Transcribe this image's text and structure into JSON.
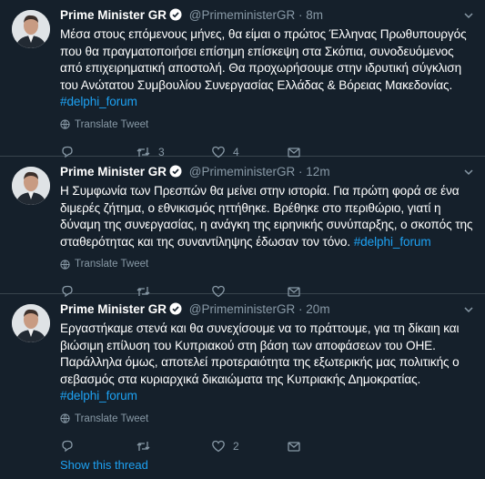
{
  "tweets": [
    {
      "name": "Prime Minister GR",
      "handle": "@PrimeministerGR",
      "dot": "·",
      "time": "8m",
      "text": "Μέσα στους επόμενους μήνες, θα είμαι ο πρώτος Έλληνας Πρωθυπουργός που θα πραγματοποιήσει επίσημη επίσκεψη στα Σκόπια, συνοδευόμενος από επιχειρηματική αποστολή. Θα προχωρήσουμε στην ιδρυτική σύγκλιση του Ανώτατου Συμβουλίου Συνεργασίας Ελλάδας & Βόρειας Μακεδονίας.",
      "hashtag": "#delphi_forum",
      "translate": "Translate Tweet",
      "replies": "",
      "retweets": "3",
      "likes": "4"
    },
    {
      "name": "Prime Minister GR",
      "handle": "@PrimeministerGR",
      "dot": "·",
      "time": "12m",
      "text": "Η Συμφωνία των Πρεσπών θα μείνει στην ιστορία. Για πρώτη φορά σε ένα διμερές ζήτημα, ο εθνικισμός ηττήθηκε. Βρέθηκε στο περιθώριο, γιατί η δύναμη της συνεργασίας, η ανάγκη της ειρηνικής συνύπαρξης, ο σκοπός της σταθερότητας και της συναντίληψης έδωσαν τον τόνο.",
      "hashtag": "#delphi_forum",
      "translate": "Translate Tweet",
      "replies": "",
      "retweets": "",
      "likes": ""
    },
    {
      "name": "Prime Minister GR",
      "handle": "@PrimeministerGR",
      "dot": "·",
      "time": "20m",
      "text": "Εργαστήκαμε στενά και θα συνεχίσουμε να το πράττουμε, για τη δίκαιη και βιώσιμη επίλυση του Κυπριακού στη βάση των αποφάσεων του ΟΗΕ. Παράλληλα όμως, αποτελεί προτεραιότητα της εξωτερικής μας πολιτικής ο σεβασμός στα κυριαρχικά δικαιώματα της Κυπριακής Δημοκρατίας.",
      "hashtag": "#delphi_forum",
      "translate": "Translate Tweet",
      "replies": "",
      "retweets": "",
      "likes": "2"
    }
  ],
  "show_thread": "Show this thread",
  "colors": {
    "background": "#15202b",
    "border": "#38444d",
    "muted": "#8899a6",
    "accent": "#1da1f2"
  },
  "icons": [
    "chevron-down-icon",
    "verified-badge-icon",
    "globe-icon",
    "reply-icon",
    "retweet-icon",
    "like-icon",
    "share-icon"
  ]
}
